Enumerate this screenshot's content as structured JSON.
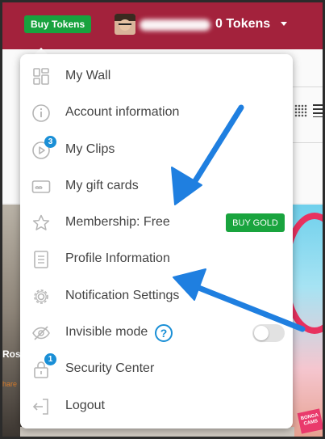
{
  "header": {
    "buy_tokens_label": "Buy Tokens",
    "tokens_label": "0  Tokens"
  },
  "background": {
    "thumbnail_name": "Ros",
    "thumbnail_caption": "hare",
    "brand_sticker": "BONGA CAMS"
  },
  "menu": {
    "items": [
      {
        "label": "My Wall",
        "icon": "wall-grid-icon"
      },
      {
        "label": "Account information",
        "icon": "info-icon"
      },
      {
        "label": "My Clips",
        "icon": "play-icon",
        "badge": "3"
      },
      {
        "label": "My gift cards",
        "icon": "gift-card-icon"
      },
      {
        "label": "Membership:  Free",
        "icon": "star-icon",
        "action_label": "BUY GOLD"
      },
      {
        "label": "Profile Information",
        "icon": "document-icon"
      },
      {
        "label": "Notification Settings",
        "icon": "gear-icon"
      },
      {
        "label": "Invisible mode",
        "icon": "eye-slash-icon",
        "help": "?",
        "toggle_on": false
      },
      {
        "label": "Security Center",
        "icon": "lock-icon",
        "badge": "1"
      },
      {
        "label": "Logout",
        "icon": "logout-icon"
      }
    ]
  },
  "colors": {
    "header_bg": "#a3223c",
    "accent_green": "#19a43e",
    "badge_blue": "#1a8fd6",
    "arrow_blue": "#1f7fe0"
  }
}
